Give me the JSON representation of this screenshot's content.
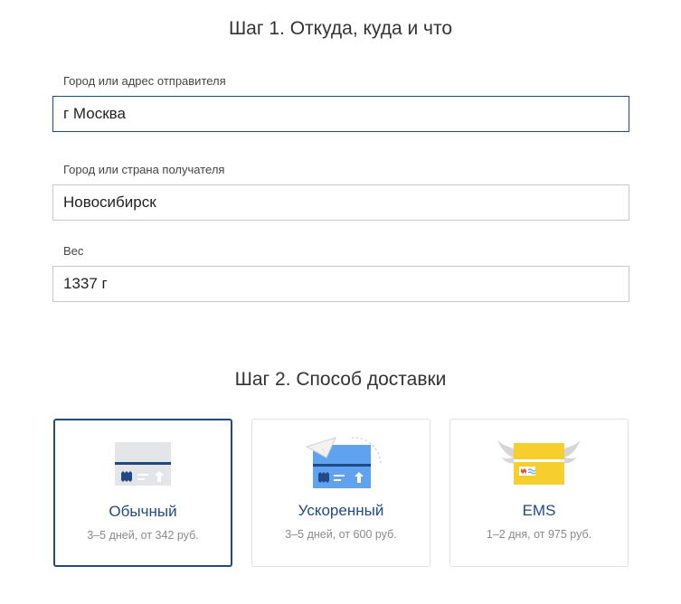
{
  "step1": {
    "title": "Шаг 1. Откуда, куда и что",
    "sender": {
      "label": "Город или адрес отправителя",
      "value": "г Москва"
    },
    "recipient": {
      "label": "Город или страна получателя",
      "value": "Новосибирск"
    },
    "weight": {
      "label": "Вес",
      "value": "1337 г"
    }
  },
  "step2": {
    "title": "Шаг 2. Способ доставки",
    "options": [
      {
        "icon": "regular-parcel-icon",
        "title": "Обычный",
        "subtitle": "3–5 дней, от 342 руб.",
        "selected": true
      },
      {
        "icon": "express-parcel-icon",
        "title": "Ускоренный",
        "subtitle": "3–5 дней, от 600 руб.",
        "selected": false
      },
      {
        "icon": "ems-parcel-icon",
        "title": "EMS",
        "subtitle": "1–2 дня, от 975 руб.",
        "selected": false
      }
    ]
  },
  "colors": {
    "accent": "#1f4a86",
    "express_blue": "#5fa3f0",
    "ems_yellow": "#f6cf2e",
    "muted": "#8a8a8a"
  }
}
